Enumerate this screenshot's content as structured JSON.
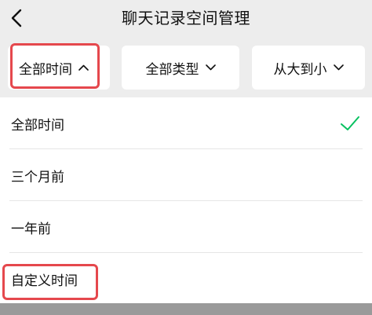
{
  "header": {
    "title": "聊天记录空间管理",
    "back_icon": "chevron-left-icon"
  },
  "filters": {
    "time": {
      "label": "全部时间",
      "icon": "chevron-up-icon",
      "expanded": true
    },
    "type": {
      "label": "全部类型",
      "icon": "chevron-down-icon"
    },
    "sort": {
      "label": "从大到小",
      "icon": "chevron-down-icon"
    }
  },
  "dropdown": {
    "options": [
      {
        "label": "全部时间",
        "selected": true
      },
      {
        "label": "三个月前",
        "selected": false
      },
      {
        "label": "一年前",
        "selected": false
      },
      {
        "label": "自定义时间",
        "selected": false
      }
    ],
    "check_icon": "checkmark-icon"
  },
  "colors": {
    "header_bg": "#ededed",
    "accent_green": "#07c160",
    "highlight_red": "#e5484d",
    "text": "#111111"
  }
}
